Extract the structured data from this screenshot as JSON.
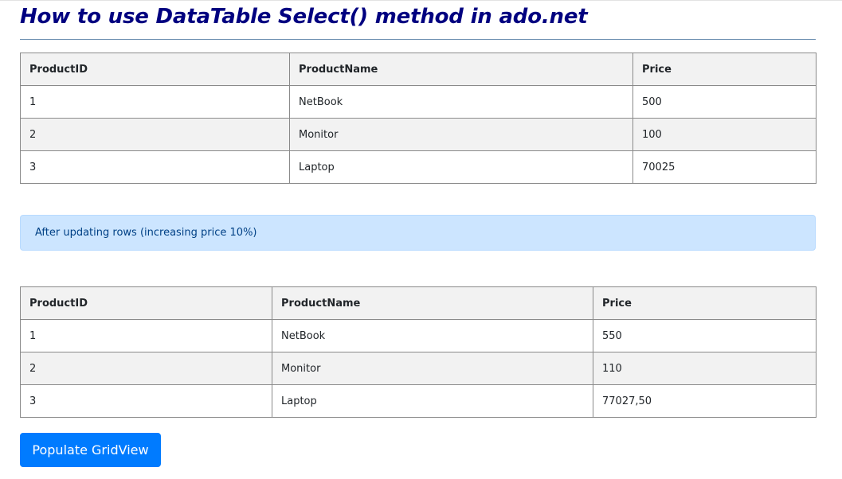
{
  "page": {
    "title": "How to use DataTable Select() method in ado.net"
  },
  "grid1": {
    "headers": [
      "ProductID",
      "ProductName",
      "Price"
    ],
    "rows": [
      [
        "1",
        "NetBook",
        "500"
      ],
      [
        "2",
        "Monitor",
        "100"
      ],
      [
        "3",
        "Laptop",
        "70025"
      ]
    ]
  },
  "alert": {
    "text": "After updating rows (increasing price 10%)"
  },
  "grid2": {
    "headers": [
      "ProductID",
      "ProductName",
      "Price"
    ],
    "rows": [
      [
        "1",
        "NetBook",
        "550"
      ],
      [
        "2",
        "Monitor",
        "110"
      ],
      [
        "3",
        "Laptop",
        "77027,50"
      ]
    ]
  },
  "actions": {
    "populate_label": "Populate GridView"
  },
  "colors": {
    "title": "#000080",
    "alert_bg": "#cce5ff",
    "alert_text": "#004085",
    "button_bg": "#007bff",
    "row_alt_bg": "#f2f2f2"
  }
}
